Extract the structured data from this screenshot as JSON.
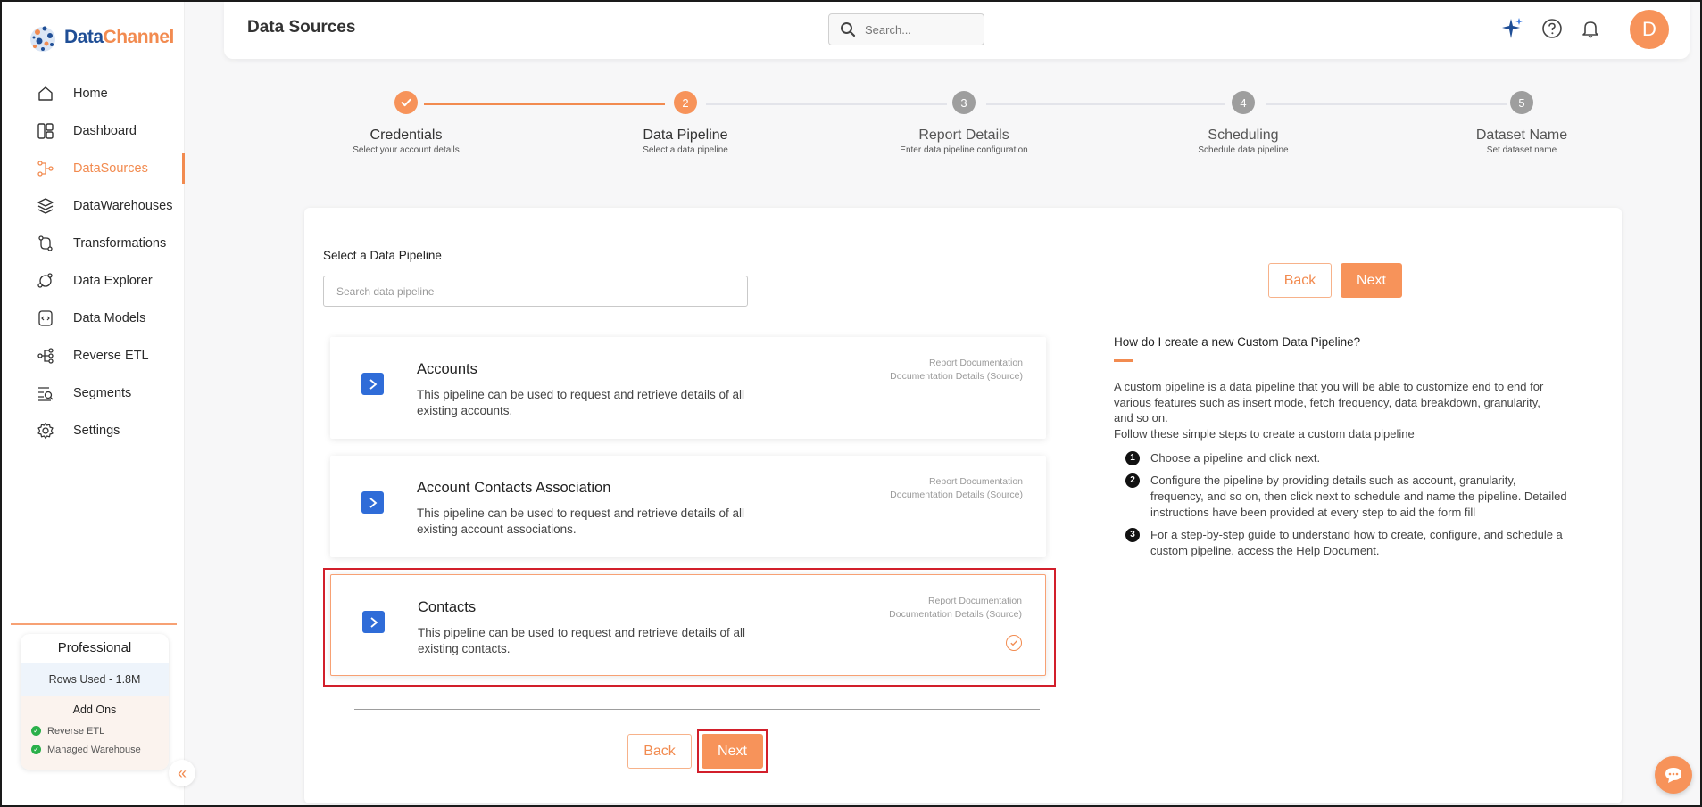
{
  "brand": {
    "name_part1": "Data",
    "name_part2": "Channel"
  },
  "sidebar": {
    "items": [
      {
        "label": "Home",
        "icon": "home-icon"
      },
      {
        "label": "Dashboard",
        "icon": "dashboard-icon"
      },
      {
        "label": "DataSources",
        "icon": "datasources-icon",
        "active": true
      },
      {
        "label": "DataWarehouses",
        "icon": "layers-icon"
      },
      {
        "label": "Transformations",
        "icon": "transform-icon"
      },
      {
        "label": "Data Explorer",
        "icon": "explorer-icon"
      },
      {
        "label": "Data Models",
        "icon": "data-model-icon"
      },
      {
        "label": "Reverse ETL",
        "icon": "reverse-etl-icon"
      },
      {
        "label": "Segments",
        "icon": "segments-icon"
      },
      {
        "label": "Settings",
        "icon": "gear-icon"
      }
    ],
    "plan": {
      "title": "Professional",
      "rows_used": "Rows Used - 1.8M",
      "addons_title": "Add Ons",
      "addons": [
        "Reverse ETL",
        "Managed Warehouse"
      ]
    },
    "collapse_glyph": "«"
  },
  "header": {
    "title": "Data Sources",
    "search_placeholder": "Search...",
    "avatar_initial": "D"
  },
  "stepper": {
    "steps": [
      {
        "number": "",
        "label": "Credentials",
        "sub": "Select your account details",
        "state": "done"
      },
      {
        "number": "2",
        "label": "Data Pipeline",
        "sub": "Select a data pipeline",
        "state": "current"
      },
      {
        "number": "3",
        "label": "Report Details",
        "sub": "Enter data pipeline configuration",
        "state": "todo"
      },
      {
        "number": "4",
        "label": "Scheduling",
        "sub": "Schedule data pipeline",
        "state": "todo"
      },
      {
        "number": "5",
        "label": "Dataset Name",
        "sub": "Set dataset name",
        "state": "todo"
      }
    ]
  },
  "main": {
    "select_label": "Select a Data Pipeline",
    "search_placeholder": "Search data pipeline",
    "doc_link1": "Report Documentation",
    "doc_link2": "Documentation Details (Source)",
    "pipelines": [
      {
        "name": "Accounts",
        "desc": "This pipeline can be used to request and retrieve details of all existing accounts.",
        "selected": false
      },
      {
        "name": "Account Contacts Association",
        "desc": "This pipeline can be used to request and retrieve details of all existing account associations.",
        "selected": false
      },
      {
        "name": "Contacts",
        "desc": "This pipeline can be used to request and retrieve details of all existing contacts.",
        "selected": true
      }
    ],
    "back_label": "Back",
    "next_label": "Next"
  },
  "help": {
    "title": "How do I create a new Custom Data Pipeline?",
    "intro": "A custom pipeline is a data pipeline that you will be able to customize end to end for various features such as insert mode, fetch frequency, data breakdown, granularity, and so on.",
    "follow": "Follow these simple steps to create a custom data pipeline",
    "steps": [
      {
        "n": "1",
        "text": "Choose a pipeline and click next."
      },
      {
        "n": "2",
        "text": "Configure the pipeline by providing details such as account, granularity, frequency, and so on, then click next to schedule and name the pipeline. Detailed instructions have been provided at every step to aid the form fill"
      },
      {
        "n": "3",
        "text": "For a step-by-step guide to understand how to create, configure, and schedule a custom pipeline, access the Help Document."
      }
    ]
  },
  "colors": {
    "accent": "#f28b50",
    "accent_fill": "#f7935a",
    "brand_blue": "#1f4e96",
    "pipeline_icon": "#2f6cd8",
    "step_todo": "#9e9e9e",
    "highlight": "#d21f2b"
  }
}
